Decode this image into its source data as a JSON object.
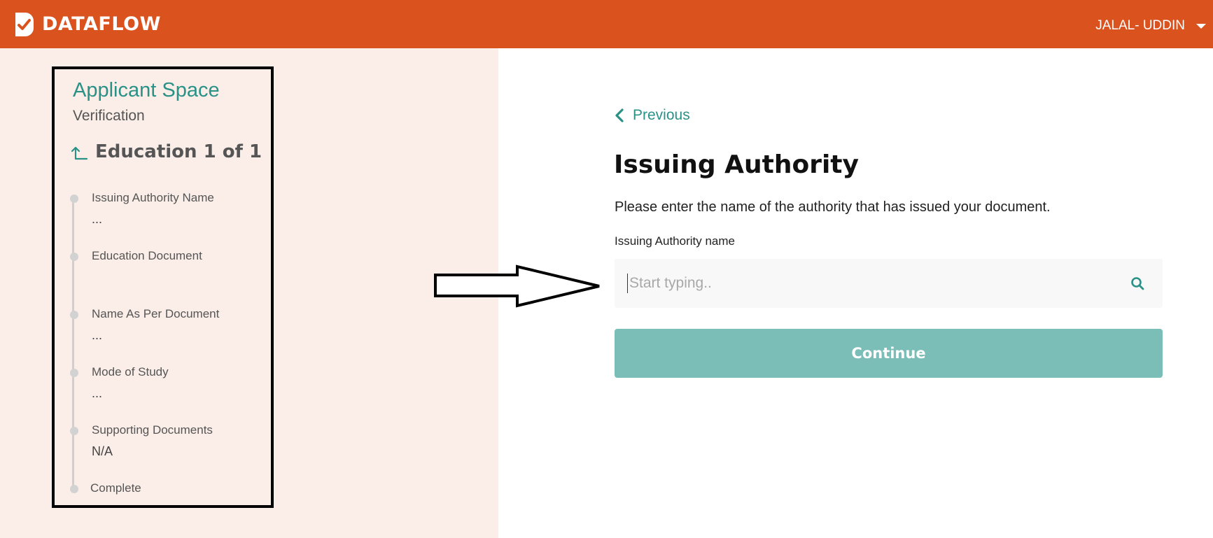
{
  "header": {
    "brand": "DATAFLOW",
    "user_name": "JALAL- UDDIN",
    "background_color": "#da531f",
    "icons": {
      "logo": "dataflow-logo-icon",
      "user_menu": "caret-down-icon"
    }
  },
  "sidebar": {
    "title": "Applicant Space",
    "subtitle": "Verification",
    "section_title": "Education 1 of 1",
    "section_icon": "return-up-arrow-icon",
    "steps": [
      {
        "label": "Issuing Authority Name",
        "value": "..."
      },
      {
        "label": "Education Document",
        "value": ""
      },
      {
        "label": "Name As Per Document",
        "value": "..."
      },
      {
        "label": "Mode of Study",
        "value": "..."
      },
      {
        "label": "Supporting Documents",
        "value": "N/A"
      },
      {
        "label": "Complete",
        "value": ""
      }
    ]
  },
  "main": {
    "previous_label": "Previous",
    "title": "Issuing Authority",
    "description": "Please enter the name of the authority that has issued your document.",
    "field_label": "Issuing Authority name",
    "search_placeholder": "Start typing..",
    "search_value": "",
    "continue_label": "Continue",
    "accent_color": "#2a9187",
    "button_color": "#7bbdb7"
  }
}
